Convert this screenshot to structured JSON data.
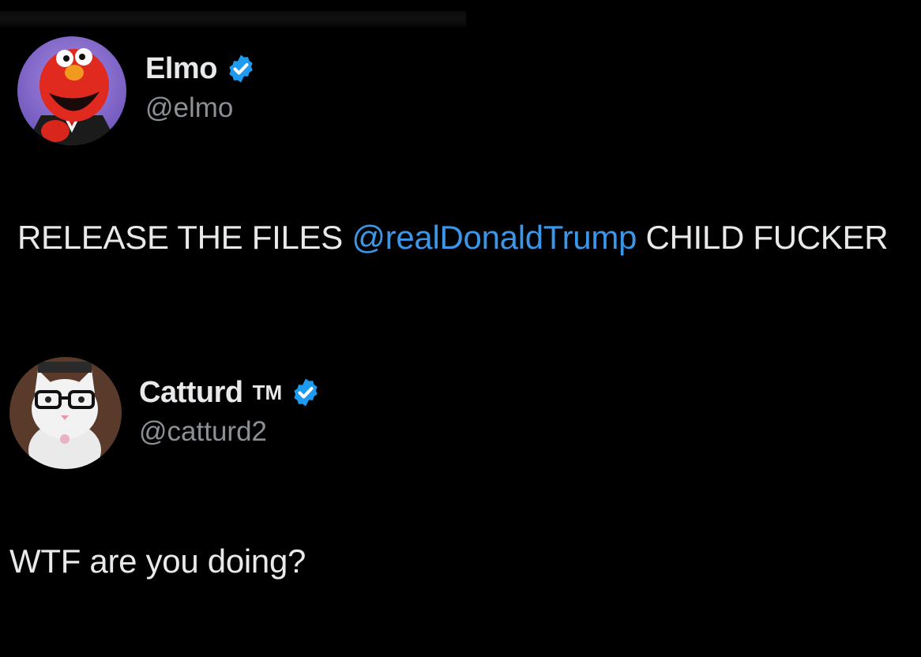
{
  "tweet1": {
    "display_name": "Elmo",
    "handle": "@elmo",
    "verified_icon": "verified-badge-icon",
    "avatar_icon": "elmo-avatar-icon",
    "text_before": "RELEASE THE FILES ",
    "mention": "@realDonaldTrump",
    "text_after": " CHILD FUCKER"
  },
  "tweet2": {
    "display_name": "Catturd",
    "trademark": "TM",
    "handle": "@catturd2",
    "verified_icon": "verified-badge-icon",
    "avatar_icon": "cat-avatar-icon",
    "text": "WTF are you doing?"
  },
  "colors": {
    "background": "#000000",
    "text": "#e7e9ea",
    "handle": "#8b9096",
    "mention": "#3a96e8",
    "verified": "#1d9bf0"
  }
}
